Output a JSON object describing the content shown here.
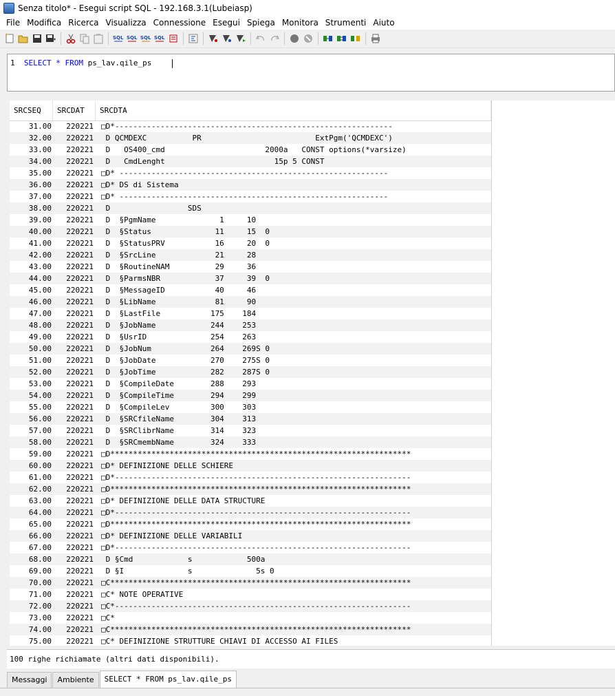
{
  "window": {
    "title": "Senza titolo* - Esegui script SQL - 192.168.3.1(Lubeiasp)"
  },
  "menu": [
    "File",
    "Modifica",
    "Ricerca",
    "Visualizza",
    "Connessione",
    "Esegui",
    "Spiega",
    "Monitora",
    "Strumenti",
    "Aiuto"
  ],
  "toolbar": {
    "icons": [
      "new-icon",
      "open-icon",
      "save-icon",
      "save-as-icon",
      "cut-icon",
      "copy-icon",
      "paste-icon",
      "run-all-icon",
      "run-selected-icon",
      "run-from-cursor-icon",
      "run-single-icon",
      "clear-icon",
      "format-icon",
      "visual-explain-icon",
      "explain-icon",
      "run-explain-icon",
      "undo-icon",
      "redo-icon",
      "stop-icon",
      "cancel-icon",
      "connect-icon",
      "reconnect-icon",
      "disconnect-icon",
      "print-icon"
    ],
    "sql_labels": [
      "SQL",
      "SQL",
      "SQL",
      "SQL"
    ]
  },
  "editor": {
    "line_number": "1",
    "kw_select": "SELECT",
    "star": "*",
    "kw_from": "FROM",
    "table": "ps_lav.qile_ps"
  },
  "grid": {
    "headers": [
      "SRCSEQ",
      "SRCDAT",
      "SRCDTA"
    ],
    "rows": [
      [
        "31.00",
        "220221",
        "□D*-------------------------------------------------------------"
      ],
      [
        "32.00",
        "220221",
        " D QCMDEXC          PR                         ExtPgm('QCMDEXC')"
      ],
      [
        "33.00",
        "220221",
        " D   OS400_cmd                      2000a   CONST options(*varsize)"
      ],
      [
        "34.00",
        "220221",
        " D   CmdLenght                        15p 5 CONST"
      ],
      [
        "35.00",
        "220221",
        "□D* -----------------------------------------------------------"
      ],
      [
        "36.00",
        "220221",
        "□D* DS di Sistema"
      ],
      [
        "37.00",
        "220221",
        "□D* -----------------------------------------------------------"
      ],
      [
        "38.00",
        "220221",
        " D                 SDS"
      ],
      [
        "39.00",
        "220221",
        " D  §PgmName              1     10"
      ],
      [
        "40.00",
        "220221",
        " D  §Status              11     15  0"
      ],
      [
        "41.00",
        "220221",
        " D  §StatusPRV           16     20  0"
      ],
      [
        "42.00",
        "220221",
        " D  §SrcLine             21     28"
      ],
      [
        "43.00",
        "220221",
        " D  §RoutineNAM          29     36"
      ],
      [
        "44.00",
        "220221",
        " D  §ParmsNBR            37     39  0"
      ],
      [
        "45.00",
        "220221",
        " D  §MessageID           40     46"
      ],
      [
        "46.00",
        "220221",
        " D  §LibName             81     90"
      ],
      [
        "47.00",
        "220221",
        " D  §LastFile           175    184"
      ],
      [
        "48.00",
        "220221",
        " D  §JobName            244    253"
      ],
      [
        "49.00",
        "220221",
        " D  §UsrID              254    263"
      ],
      [
        "50.00",
        "220221",
        " D  §JobNum             264    269S 0"
      ],
      [
        "51.00",
        "220221",
        " D  §JobDate            270    275S 0"
      ],
      [
        "52.00",
        "220221",
        " D  §JobTime            282    287S 0"
      ],
      [
        "53.00",
        "220221",
        " D  §CompileDate        288    293"
      ],
      [
        "54.00",
        "220221",
        " D  §CompileTime        294    299"
      ],
      [
        "55.00",
        "220221",
        " D  §CompileLev         300    303"
      ],
      [
        "56.00",
        "220221",
        " D  §SRCfileName        304    313"
      ],
      [
        "57.00",
        "220221",
        " D  §SRClibrName        314    323"
      ],
      [
        "58.00",
        "220221",
        " D  §SRCmembName        324    333"
      ],
      [
        "59.00",
        "220221",
        "□D******************************************************************"
      ],
      [
        "60.00",
        "220221",
        "□D* DEFINIZIONE DELLE SCHIERE"
      ],
      [
        "61.00",
        "220221",
        "□D*-----------------------------------------------------------------"
      ],
      [
        "62.00",
        "220221",
        "□D******************************************************************"
      ],
      [
        "63.00",
        "220221",
        "□D* DEFINIZIONE DELLE DATA STRUCTURE"
      ],
      [
        "64.00",
        "220221",
        "□D*-----------------------------------------------------------------"
      ],
      [
        "65.00",
        "220221",
        "□D******************************************************************"
      ],
      [
        "66.00",
        "220221",
        "□D* DEFINIZIONE DELLE VARIABILI"
      ],
      [
        "67.00",
        "220221",
        "□D*-----------------------------------------------------------------"
      ],
      [
        "68.00",
        "220221",
        " D §Cmd            s            500a"
      ],
      [
        "69.00",
        "220221",
        " D §I              s              5s 0"
      ],
      [
        "70.00",
        "220221",
        "□C******************************************************************"
      ],
      [
        "71.00",
        "220221",
        "□C* NOTE OPERATIVE"
      ],
      [
        "72.00",
        "220221",
        "□C*-----------------------------------------------------------------"
      ],
      [
        "73.00",
        "220221",
        "□C*"
      ],
      [
        "74.00",
        "220221",
        "□C******************************************************************"
      ],
      [
        "75.00",
        "220221",
        "□C* DEFINIZIONE STRUTTURE CHIAVI DI ACCESSO AI FILES"
      ]
    ]
  },
  "status": {
    "text": "100 righe richiamate (altri dati disponibili)."
  },
  "tabs": [
    "Messaggi",
    "Ambiente",
    "SELECT * FROM ps_lav.qile_ps"
  ],
  "colors": {
    "keyword": "#0000ff",
    "alt_row": "#f2f2f2"
  }
}
